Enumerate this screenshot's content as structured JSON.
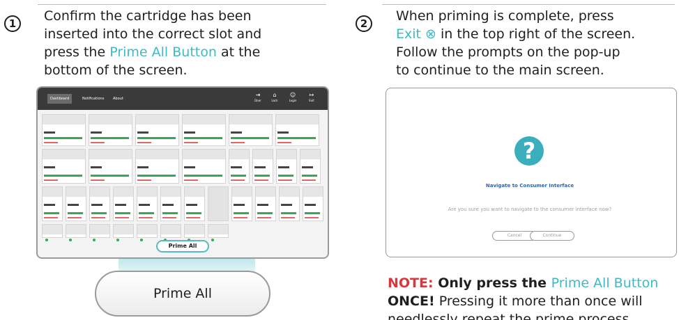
{
  "step1": {
    "number": "1",
    "line1": "Confirm the cartridge has been",
    "line2": "inserted into the correct slot and",
    "line3_pre": "press the ",
    "line3_accent": "Prime All Button",
    "line3_post": " at the",
    "line4": "bottom of the screen."
  },
  "step2": {
    "number": "2",
    "line1": "When priming is complete, press",
    "line2_accent": "Exit ⊗",
    "line2_post": " in the top right of the screen.",
    "line3": "Follow the prompts on the pop-up",
    "line4": "to continue to the main screen."
  },
  "mock_screen": {
    "tabs": [
      "Dashboard",
      "Notifications",
      "About"
    ],
    "icons": [
      {
        "icon": "door-icon",
        "glyph": "⇥",
        "label": "Door"
      },
      {
        "icon": "lock-icon",
        "glyph": "⌂",
        "label": "Lock"
      },
      {
        "icon": "login-icon",
        "glyph": "☺",
        "label": "Login"
      },
      {
        "icon": "exit-icon",
        "glyph": "↦",
        "label": "Exit"
      }
    ],
    "prime_label": "Prime All"
  },
  "big_button": {
    "label": "Prime All"
  },
  "dialog": {
    "title": "Navigate to Consumer Interface",
    "message": "Are you sure you want to navigate to the consumer interface now?",
    "cancel": "Cancel",
    "continue": "Continue"
  },
  "note": {
    "label": "NOTE:",
    "text1": " Only press the ",
    "accent": "Prime All Button",
    "line2_bold": "ONCE!",
    "line2": " Pressing it more than once will",
    "line3": "needlessly repeat the prime process."
  },
  "colors": {
    "accent": "#3fb9c6",
    "note": "#d9363e",
    "ok": "#34a853"
  }
}
